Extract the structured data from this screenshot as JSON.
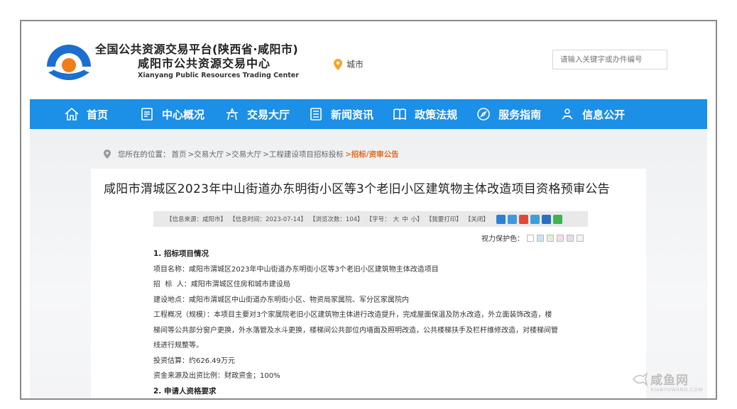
{
  "header": {
    "title_line1": "全国公共资源交易平台(陕西省·咸阳市)",
    "title_line2": "咸阳市公共资源交易中心",
    "title_en": "Xianyang Public Resources Trading Center",
    "city_label": "城市",
    "search_placeholder": "请输入关键字或办件编号"
  },
  "nav": {
    "items": [
      {
        "label": "首页",
        "icon": "home-icon"
      },
      {
        "label": "中心概况",
        "icon": "document-icon"
      },
      {
        "label": "交易大厅",
        "icon": "hall-icon"
      },
      {
        "label": "新闻资讯",
        "icon": "news-icon"
      },
      {
        "label": "政策法规",
        "icon": "book-icon"
      },
      {
        "label": "服务指南",
        "icon": "compass-icon"
      },
      {
        "label": "信息公开",
        "icon": "info-icon"
      }
    ]
  },
  "breadcrumb": {
    "prefix": "您所在的位置：",
    "items": [
      "首页",
      ">交易大厅",
      ">交易大厅",
      ">工程建设项目招标投标"
    ],
    "current": ">招标/资审公告"
  },
  "article": {
    "title": "咸阳市渭城区2023年中山街道办东明街小区等3个老旧小区建筑物主体改造项目资格预审公告",
    "meta": {
      "source": "【信息来源：咸阳市】",
      "time": "【信息时间：2023-07-14】",
      "views": "【浏览次数：104】",
      "font_size_label": "【字号：",
      "font_large": "大",
      "font_medium": "中",
      "font_small": "小】",
      "print": "【我要打印】",
      "close": "【关闭】"
    },
    "protect_label": "视力保护色：",
    "protect_colors": [
      "#ffffff",
      "#c9e4f5",
      "#e3f0d8",
      "#f6dde5",
      "#e6dcf2",
      "#f4f4f4"
    ],
    "sections": [
      {
        "heading": "1. 招标项目情况"
      },
      {
        "line": "项目名称：咸阳市渭城区2023年中山街道办东明街小区等3个老旧小区建筑物主体改造项目"
      },
      {
        "line": "招  标  人：咸阳市渭城区住房和城市建设局"
      },
      {
        "line": "建设地点：咸阳市渭城区中山街道办东明街小区、物资局家属院、军分区家属院内"
      },
      {
        "line": "工程概况（规模）：本项目主要对3个家属院老旧小区建筑物主体进行改造提升，完成屋面保温及防水改造，外立面装饰改造，楼"
      },
      {
        "line": "梯间等公共部分窗户更换，外水落管及水斗更换，楼梯间公共部位内墙面及照明改造，公共楼梯扶手及栏杆维修改造，对楼梯间管"
      },
      {
        "line": "线进行规整等。"
      },
      {
        "line": "投资估算：约626.49万元"
      },
      {
        "line": "资金来源及出资比例：财政资金；100%"
      },
      {
        "heading": "2. 申请人资格要求"
      }
    ]
  },
  "watermark": {
    "text": "咸鱼网",
    "sub": "XIANYUWANG.COM"
  }
}
